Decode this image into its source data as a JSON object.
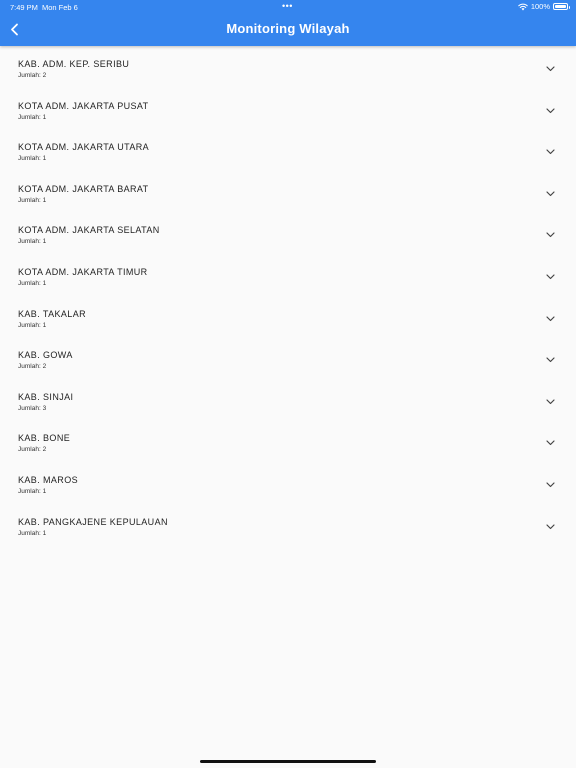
{
  "status_bar": {
    "time": "7:49 PM",
    "date": "Mon Feb 6",
    "dots": "•••",
    "battery": "100%"
  },
  "header": {
    "title": "Monitoring Wilayah",
    "back_icon": "chevron-left-icon"
  },
  "colors": {
    "header_bg": "#3585ee",
    "page_bg": "#fafafa"
  },
  "list": {
    "items": [
      {
        "title": "KAB. ADM. KEP. SERIBU",
        "count": "Jumlah: 2"
      },
      {
        "title": "KOTA ADM. JAKARTA PUSAT",
        "count": "Jumlah: 1"
      },
      {
        "title": "KOTA ADM. JAKARTA UTARA",
        "count": "Jumlah: 1"
      },
      {
        "title": "KOTA ADM. JAKARTA BARAT",
        "count": "Jumlah: 1"
      },
      {
        "title": "KOTA ADM. JAKARTA SELATAN",
        "count": "Jumlah: 1"
      },
      {
        "title": "KOTA ADM. JAKARTA TIMUR",
        "count": "Jumlah: 1"
      },
      {
        "title": "KAB. TAKALAR",
        "count": "Jumlah: 1"
      },
      {
        "title": "KAB. GOWA",
        "count": "Jumlah: 2"
      },
      {
        "title": "KAB. SINJAI",
        "count": "Jumlah: 3"
      },
      {
        "title": "KAB. BONE",
        "count": "Jumlah: 2"
      },
      {
        "title": "KAB. MAROS",
        "count": "Jumlah: 1"
      },
      {
        "title": "KAB. PANGKAJENE KEPULAUAN",
        "count": "Jumlah: 1"
      }
    ],
    "expand_icon": "chevron-down-icon"
  }
}
